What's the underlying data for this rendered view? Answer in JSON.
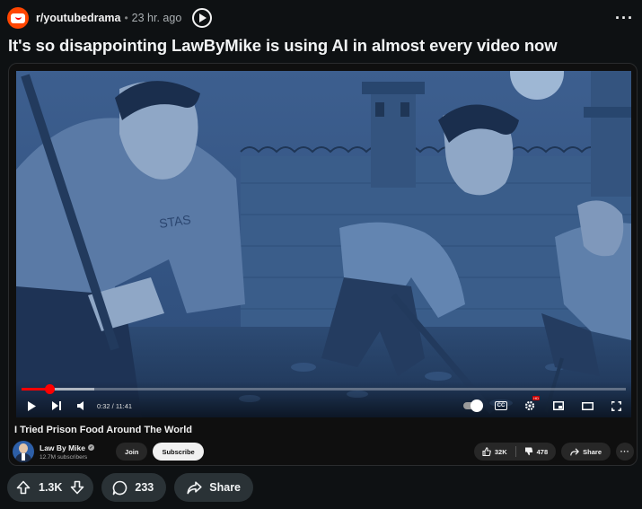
{
  "post": {
    "subreddit": "r/youtubedrama",
    "separator": "•",
    "time": "23 hr. ago",
    "title": "It's so disappointing LawByMike is using AI in almost every video now",
    "more_icon": "more-horizontal-icon"
  },
  "video": {
    "title": "I Tried Prison Food Around The World",
    "timecode": "0:32 / 11:41",
    "progress_fraction": 0.046,
    "buffered_fraction": 0.12,
    "shirt_text": "STAS",
    "channel": {
      "name": "Law By Mike",
      "subscribers": "12.7M subscribers"
    },
    "join_label": "Join",
    "subscribe_label": "Subscribe",
    "likes": "32K",
    "dislikes": "478",
    "share_label": "Share",
    "cc_label": "CC",
    "hd_label": "HD",
    "more_label": "···"
  },
  "actions": {
    "upvotes": "1.3K",
    "comments": "233",
    "share_label": "Share"
  },
  "colors": {
    "background": "#0e1113",
    "accent_red": "#ff0000",
    "reddit_orange": "#ff4500",
    "button_bg": "#2a3236"
  }
}
